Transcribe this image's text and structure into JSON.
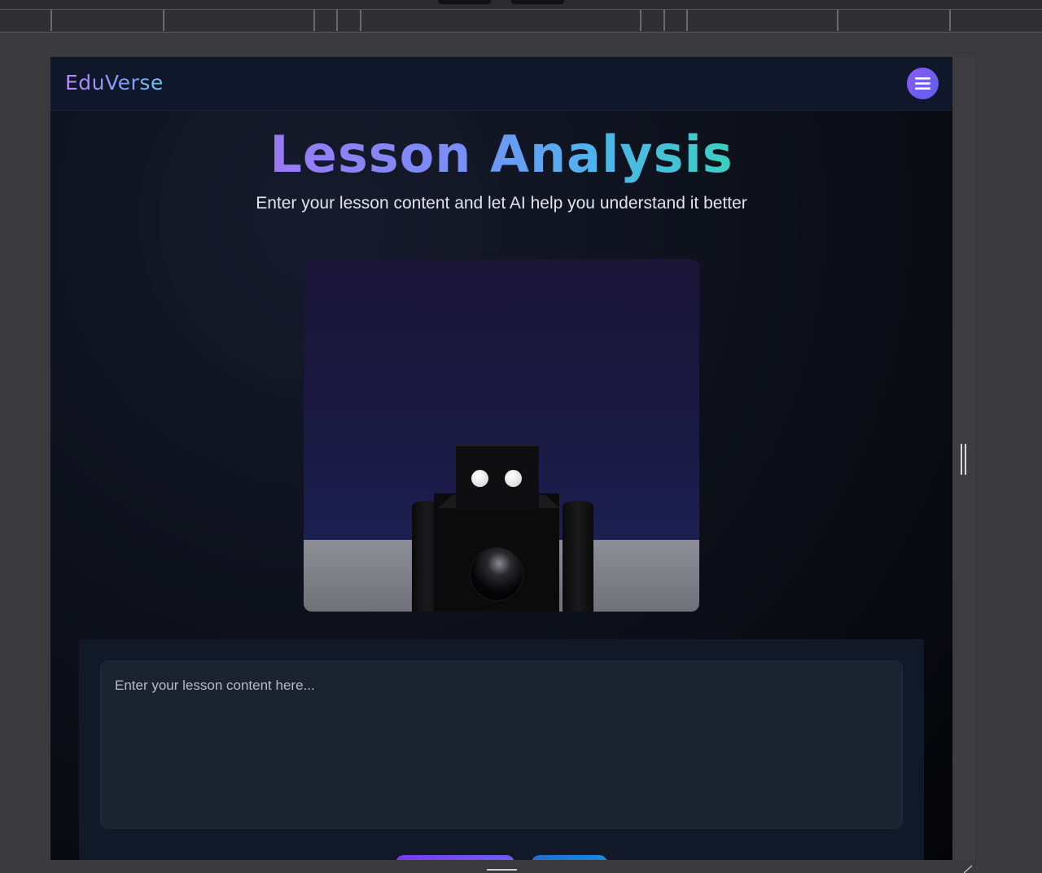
{
  "app": {
    "logo": "EduVerse",
    "menu_icon": "hamburger-menu-icon",
    "accent_colors": {
      "purple": "#8a5cf6",
      "blue": "#4fb3ee",
      "teal": "#3ccfbf"
    }
  },
  "hero": {
    "title": "Lesson Analysis",
    "subtitle": "Enter your lesson content and let AI help you understand it better"
  },
  "scene": {
    "description_icon": "robot-3d-model"
  },
  "lesson_form": {
    "placeholder": "Enter your lesson content here...",
    "value": ""
  }
}
